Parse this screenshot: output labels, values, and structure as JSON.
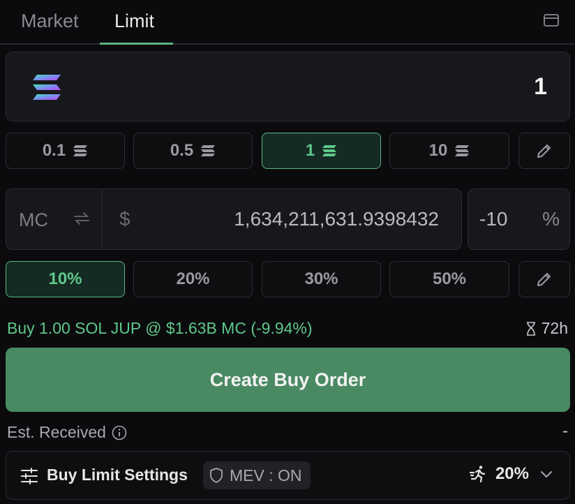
{
  "tabs": {
    "market": "Market",
    "limit": "Limit"
  },
  "amount": {
    "value": "1"
  },
  "amount_presets": [
    {
      "label": "0.1"
    },
    {
      "label": "0.5"
    },
    {
      "label": "1"
    },
    {
      "label": "10"
    }
  ],
  "price": {
    "mode_label": "MC",
    "currency": "$",
    "value": "1,634,211,631.9398432",
    "percent_value": "-10",
    "percent_sign": "%"
  },
  "percent_presets": [
    {
      "label": "10%"
    },
    {
      "label": "20%"
    },
    {
      "label": "30%"
    },
    {
      "label": "50%"
    }
  ],
  "summary": {
    "text": "Buy 1.00 SOL JUP @ $1.63B MC (-9.94%)",
    "expiry": "72h"
  },
  "create_button": {
    "label": "Create Buy Order"
  },
  "estimate": {
    "label": "Est. Received",
    "value": "-"
  },
  "settings": {
    "label": "Buy Limit Settings",
    "mev": "MEV : ON",
    "slippage": "20%"
  },
  "colors": {
    "accent": "#5fc88a",
    "button": "#4a8a63",
    "background": "#0b0b0d",
    "panel": "#17181b"
  }
}
